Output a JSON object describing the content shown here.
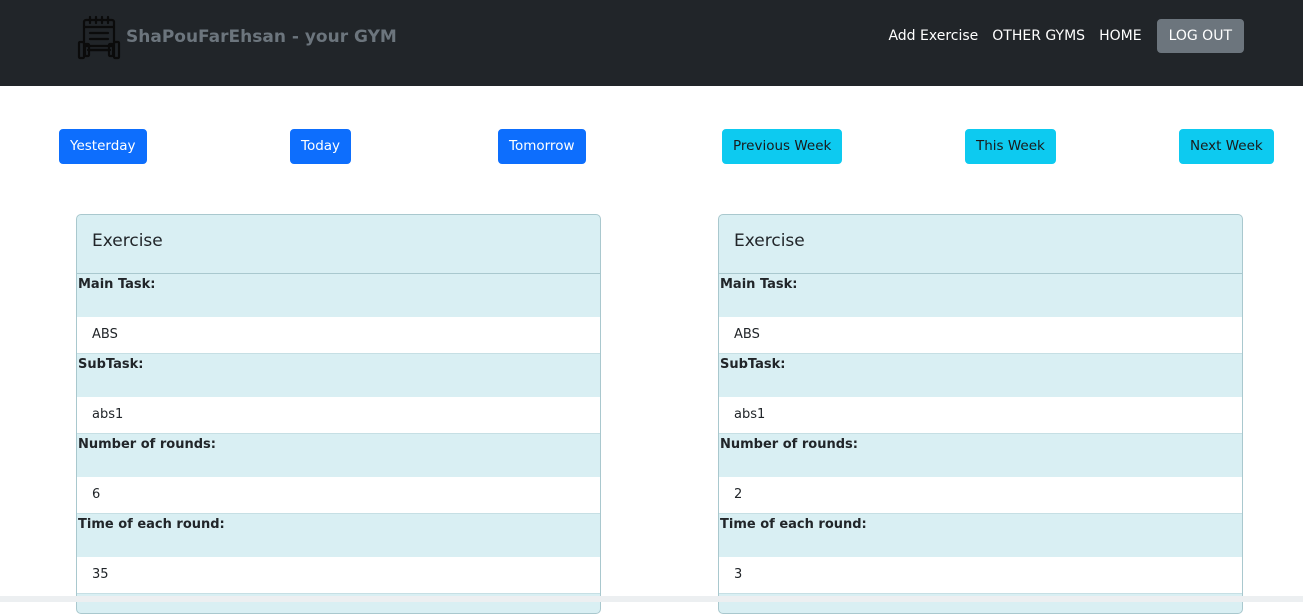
{
  "navbar": {
    "brand": "ShaPouFarEhsan - your GYM",
    "logo_icon": "gym-calendar-dumbbell-icon",
    "links": {
      "add_exercise": "Add Exercise",
      "other_gyms": "OTHER GYMS",
      "home": "HOME"
    },
    "logout": "LOG OUT"
  },
  "date_nav": {
    "yesterday": "Yesterday",
    "today": "Today",
    "tomorrow": "Tomorrow",
    "previous_week": "Previous Week",
    "this_week": "This Week",
    "next_week": "Next Week"
  },
  "labels": {
    "main_task": "Main Task:",
    "subtask": "SubTask:",
    "rounds": "Number of rounds:",
    "round_time": "Time of each round:"
  },
  "cards": [
    {
      "header": "Exercise",
      "main_task": "ABS",
      "subtask": "abs1",
      "rounds": "6",
      "round_time": "35"
    },
    {
      "header": "Exercise",
      "main_task": "ABS",
      "subtask": "abs1",
      "rounds": "2",
      "round_time": "3"
    }
  ],
  "colors": {
    "navbar_bg": "#212529",
    "primary": "#0d6efd",
    "info": "#0dcaf0",
    "card_bg": "#d9eff3",
    "logout_bg": "#6c757d"
  }
}
